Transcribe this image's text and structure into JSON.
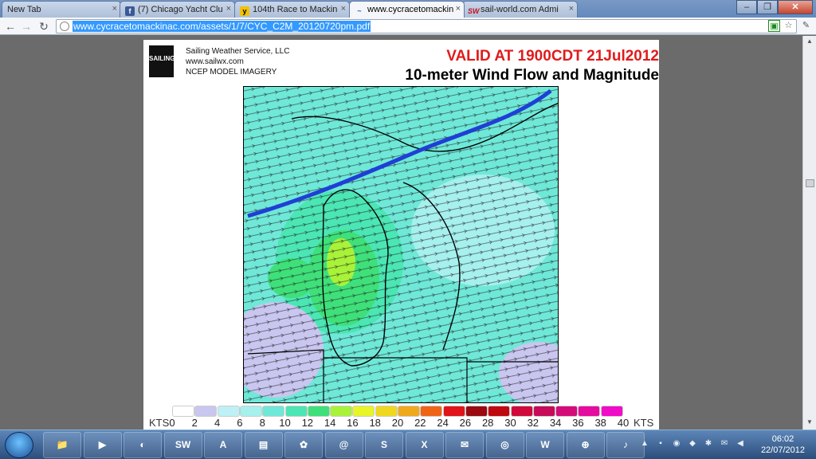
{
  "browser": {
    "tabs": [
      {
        "label": "New Tab",
        "favicon": "",
        "active": false
      },
      {
        "label": "(7) Chicago Yacht Clu",
        "favicon": "f",
        "active": false
      },
      {
        "label": "104th Race to Mackin",
        "favicon": "y",
        "active": false
      },
      {
        "label": "www.cycracetomackin",
        "favicon": "~",
        "active": true
      },
      {
        "label": "sail-world.com Admi",
        "favicon": "SW",
        "active": false
      }
    ],
    "url": "www.cycracetomackinac.com/assets/1/7/CYC_C2M_20120720pm.pdf"
  },
  "pdf": {
    "logo_text": "SAILING",
    "company_name": "Sailing Weather Service, LLC",
    "company_url": "www.sailwx.com",
    "company_sub": "NCEP MODEL IMAGERY",
    "valid": "VALID AT 1900CDT 21Jul2012",
    "title": "10-meter Wind Flow and Magnitude",
    "legend": {
      "unit_left": "KTS",
      "unit_right": "KTS",
      "ticks": [
        "0",
        "2",
        "4",
        "6",
        "8",
        "10",
        "12",
        "14",
        "16",
        "18",
        "20",
        "22",
        "24",
        "26",
        "28",
        "30",
        "32",
        "34",
        "36",
        "38",
        "40"
      ],
      "colors": [
        "#ffffff",
        "#c9c6f0",
        "#bff0f5",
        "#a6f0ee",
        "#6fe8d8",
        "#4be6b4",
        "#3fe07a",
        "#a8f23a",
        "#e8f526",
        "#f0d81e",
        "#f0a81c",
        "#f06418",
        "#e0141a",
        "#9a0a10",
        "#c00810",
        "#d00a3c",
        "#c80a5a",
        "#d40c7a",
        "#e60ca0",
        "#f00cc8"
      ]
    }
  },
  "taskbar": {
    "apps": [
      "folder",
      "media",
      "browser-old",
      "SW",
      "acrobat",
      "files",
      "chili",
      "mail",
      "skype",
      "excel",
      "thunderbird",
      "chrome",
      "word",
      "network",
      "itunes"
    ],
    "time": "06:02",
    "date": "22/07/2012"
  }
}
